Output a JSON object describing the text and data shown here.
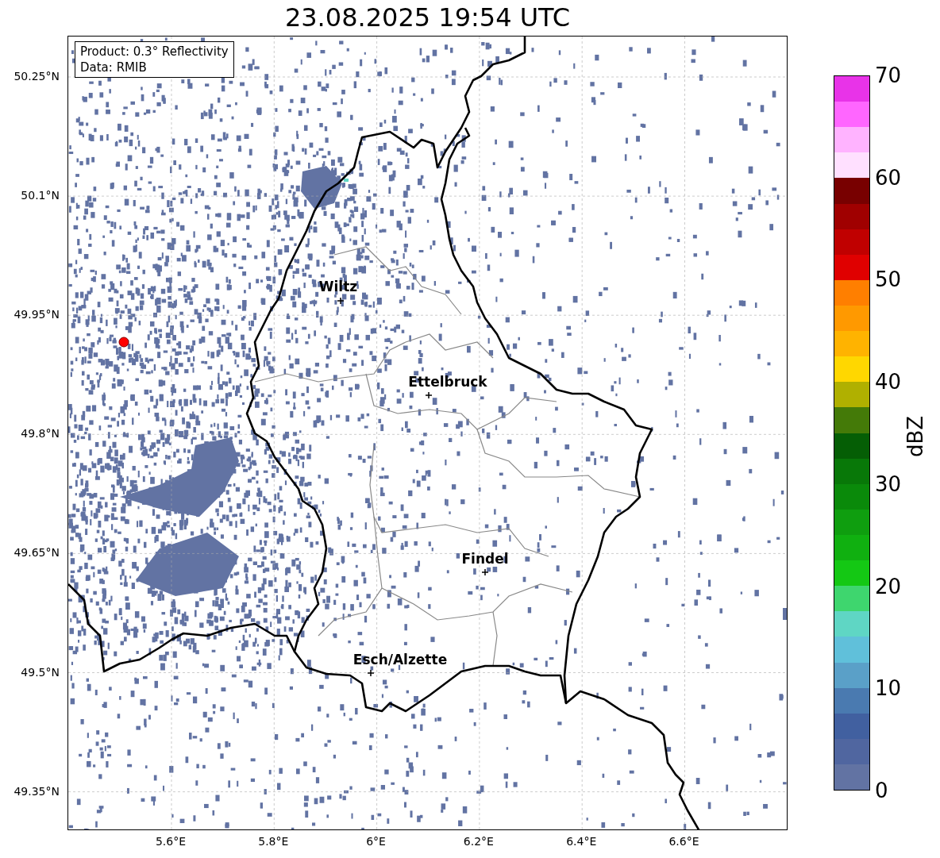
{
  "title": "23.08.2025 19:54 UTC",
  "info_box": [
    "Product: 0.3° Reflectivity",
    "Data: RMIB"
  ],
  "cities": [
    {
      "name": "Wiltz"
    },
    {
      "name": "Ettelbruck"
    },
    {
      "name": "Findel"
    },
    {
      "name": "Esch/Alzette"
    }
  ],
  "y_ticks": [
    "50.25°N",
    "50.1°N",
    "49.95°N",
    "49.8°N",
    "49.65°N",
    "49.5°N",
    "49.35°N"
  ],
  "x_ticks": [
    "5.6°E",
    "5.8°E",
    "6°E",
    "6.2°E",
    "6.4°E",
    "6.6°E"
  ],
  "colorbar": {
    "label": "dBZ",
    "ticks": [
      "70",
      "60",
      "50",
      "40",
      "30",
      "20",
      "10",
      "0"
    ],
    "segments": [
      {
        "color": "#e833e8"
      },
      {
        "color": "#ff66ff"
      },
      {
        "color": "#ffb3ff"
      },
      {
        "color": "#ffe0ff"
      },
      {
        "color": "#780000"
      },
      {
        "color": "#a00000"
      },
      {
        "color": "#c00000"
      },
      {
        "color": "#e00000"
      },
      {
        "color": "#ff7f00"
      },
      {
        "color": "#ff9900"
      },
      {
        "color": "#ffb300"
      },
      {
        "color": "#ffd700"
      },
      {
        "color": "#b0b000"
      },
      {
        "color": "#447a08"
      },
      {
        "color": "#055e05"
      },
      {
        "color": "#087808"
      },
      {
        "color": "#0a8a0a"
      },
      {
        "color": "#0f9e0f"
      },
      {
        "color": "#10b010"
      },
      {
        "color": "#14c814"
      },
      {
        "color": "#3ed66e"
      },
      {
        "color": "#5fd6c4"
      },
      {
        "color": "#60c0da"
      },
      {
        "color": "#5aa0c8"
      },
      {
        "color": "#4a7ab0"
      },
      {
        "color": "#4160a0"
      },
      {
        "color": "#5066a0"
      },
      {
        "color": "#6273a3"
      }
    ]
  }
}
